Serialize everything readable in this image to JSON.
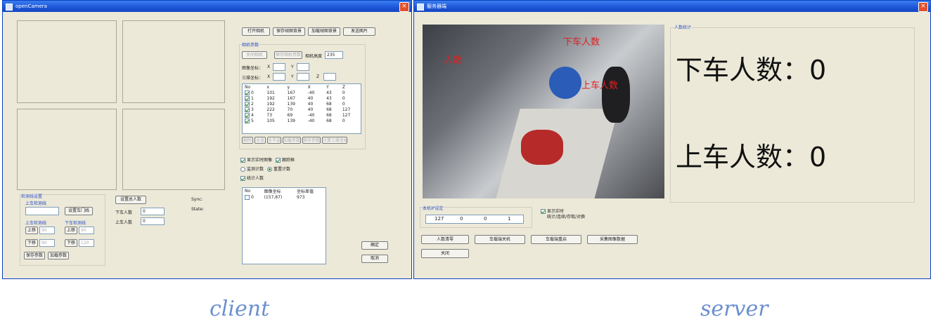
{
  "client": {
    "title": "openCamera",
    "caption": "client",
    "top_buttons": [
      "打开相机",
      "保存帧图背景",
      "加载帧图背景",
      "发送图片"
    ],
    "camera_params": {
      "group": "相机参数",
      "btn1": "关闭相机",
      "btn2": "保存相机参数",
      "height_label": "相机高度",
      "height_value": "235",
      "pos_label": "图像坐标：",
      "pos_x": "X",
      "pos_y": "Y",
      "coord_label": "三维坐标：",
      "coord_x": "X",
      "coord_y": "Y",
      "coord_z": "Z"
    },
    "table": {
      "headers": [
        "No",
        "x",
        "y",
        "X",
        "Y",
        "Z"
      ],
      "rows": [
        [
          "0",
          "101",
          "167",
          "-40",
          "43",
          "0"
        ],
        [
          "1",
          "192",
          "167",
          "40",
          "43",
          "0"
        ],
        [
          "2",
          "192",
          "139",
          "40",
          "68",
          "0"
        ],
        [
          "3",
          "222",
          "70",
          "40",
          "68",
          "127"
        ],
        [
          "4",
          "73",
          "69",
          "-40",
          "68",
          "127"
        ],
        [
          "5",
          "105",
          "139",
          "-40",
          "68",
          "0"
        ]
      ]
    },
    "table_buttons": [
      "删除",
      "全选",
      "全不选",
      "加载参数",
      "保存参数",
      "计算三维坐标"
    ],
    "options": {
      "show_realtime": "显示实时图像",
      "tracking": "跟踪框",
      "radio1": "监测计数",
      "radio2": "重置计数",
      "count_people": "统计人数"
    },
    "result_table": {
      "headers": [
        "No",
        "图像坐标",
        "坐标差值"
      ],
      "rows": [
        [
          "0",
          "(157,87)",
          "973"
        ]
      ]
    },
    "line_settings": {
      "group": "检测线设置",
      "up_line_label": "上车检测线",
      "set_door_button": "设置车门线",
      "up_label": "上车检测线",
      "down_label": "下车检测线",
      "up_btn": "上移",
      "down_btn": "下移",
      "up_btn2": "上移",
      "down_btn2": "下移",
      "val_a": "90",
      "val_b": "90",
      "val_c": "90",
      "val_d": "120",
      "save_params": "保存参数",
      "load_params": "加载参数"
    },
    "counts": {
      "set_button": "设置总人数",
      "down_label": "下车人数",
      "down_value": "0",
      "up_label": "上车人数",
      "up_value": "0",
      "sync_label": "Sync:",
      "state_label": "State:"
    },
    "ok_button": "确定",
    "cancel_button": "取消"
  },
  "server": {
    "title": "服务器端",
    "caption": "server",
    "cam_overlay": {
      "t1": "下车人数",
      "t2": "上车人数",
      "t3": "人数"
    },
    "stats_group": "人数统计",
    "down_count_label": "下车人数：",
    "down_count_value": "0",
    "up_count_label": "上车人数：",
    "up_count_value": "0",
    "ip_group": "本机IP设定",
    "ip": [
      "127",
      "0",
      "0",
      "1"
    ],
    "checkbox_label": "显示实时",
    "checkbox_sub": "统计/连续/存取/对换",
    "buttons": [
      "人数清零",
      "车载端关机",
      "车载端重启",
      "采集图像数据"
    ],
    "close_button": "关闭"
  }
}
